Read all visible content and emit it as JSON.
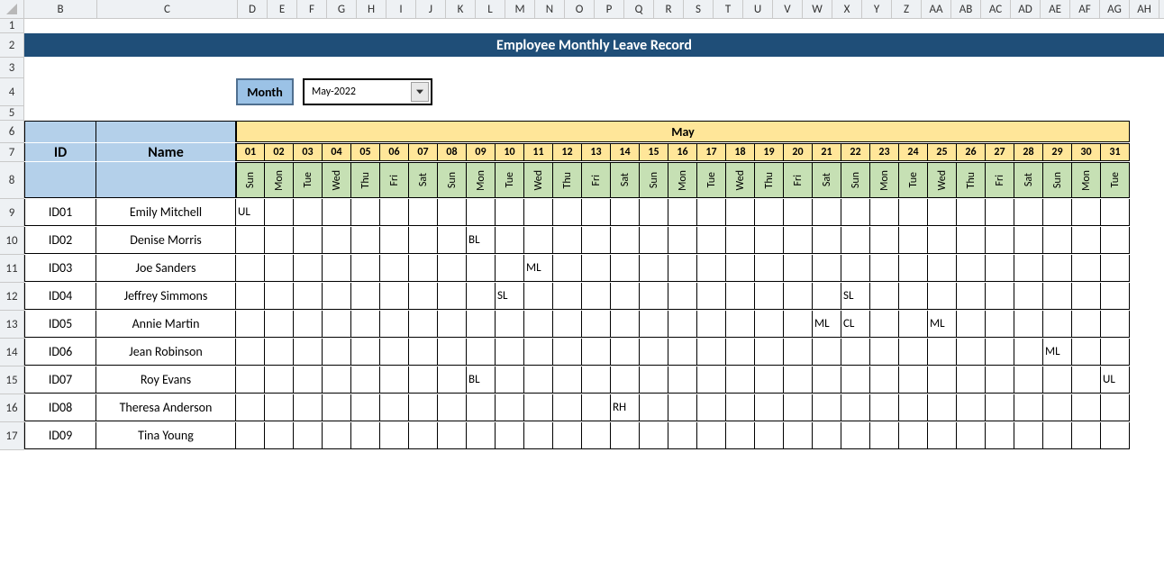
{
  "title": "Employee Monthly Leave Record",
  "month_label": "Month",
  "month_value": "May-2022",
  "month_header": "May",
  "columns": [
    "B",
    "C",
    "D",
    "E",
    "F",
    "G",
    "H",
    "I",
    "J",
    "K",
    "L",
    "M",
    "N",
    "O",
    "P",
    "Q",
    "R",
    "S",
    "T",
    "U",
    "V",
    "W",
    "X",
    "Y",
    "Z",
    "AA",
    "AB",
    "AC",
    "AD",
    "AE",
    "AF",
    "AG",
    "AH"
  ],
  "row_numbers": [
    "1",
    "2",
    "3",
    "4",
    "5",
    "6",
    "7",
    "8",
    "9",
    "10",
    "11",
    "12",
    "13",
    "14",
    "15",
    "16",
    "17"
  ],
  "headers": {
    "id": "ID",
    "name": "Name"
  },
  "days": [
    "01",
    "02",
    "03",
    "04",
    "05",
    "06",
    "07",
    "08",
    "09",
    "10",
    "11",
    "12",
    "13",
    "14",
    "15",
    "16",
    "17",
    "18",
    "19",
    "20",
    "21",
    "22",
    "23",
    "24",
    "25",
    "26",
    "27",
    "28",
    "29",
    "30",
    "31"
  ],
  "weekdays": [
    "Sun",
    "Mon",
    "Tue",
    "Wed",
    "Thu",
    "Fri",
    "Sat",
    "Sun",
    "Mon",
    "Tue",
    "Wed",
    "Thu",
    "Fri",
    "Sat",
    "Sun",
    "Mon",
    "Tue",
    "Wed",
    "Thu",
    "Fri",
    "Sat",
    "Sun",
    "Mon",
    "Tue",
    "Wed",
    "Thu",
    "Fri",
    "Sat",
    "Sun",
    "Mon",
    "Tue"
  ],
  "employees": [
    {
      "id": "ID01",
      "name": "Emily Mitchell",
      "leaves": {
        "0": "UL"
      }
    },
    {
      "id": "ID02",
      "name": "Denise Morris",
      "leaves": {
        "8": "BL"
      }
    },
    {
      "id": "ID03",
      "name": "Joe Sanders",
      "leaves": {
        "10": "ML"
      }
    },
    {
      "id": "ID04",
      "name": "Jeffrey Simmons",
      "leaves": {
        "9": "SL",
        "21": "SL"
      }
    },
    {
      "id": "ID05",
      "name": "Annie Martin",
      "leaves": {
        "20": "ML",
        "21": "CL",
        "24": "ML"
      }
    },
    {
      "id": "ID06",
      "name": "Jean Robinson",
      "leaves": {
        "28": "ML"
      }
    },
    {
      "id": "ID07",
      "name": "Roy Evans",
      "leaves": {
        "8": "BL",
        "30": "UL"
      }
    },
    {
      "id": "ID08",
      "name": "Theresa Anderson",
      "leaves": {
        "13": "RH"
      }
    },
    {
      "id": "ID09",
      "name": "Tina Young",
      "leaves": {}
    }
  ]
}
